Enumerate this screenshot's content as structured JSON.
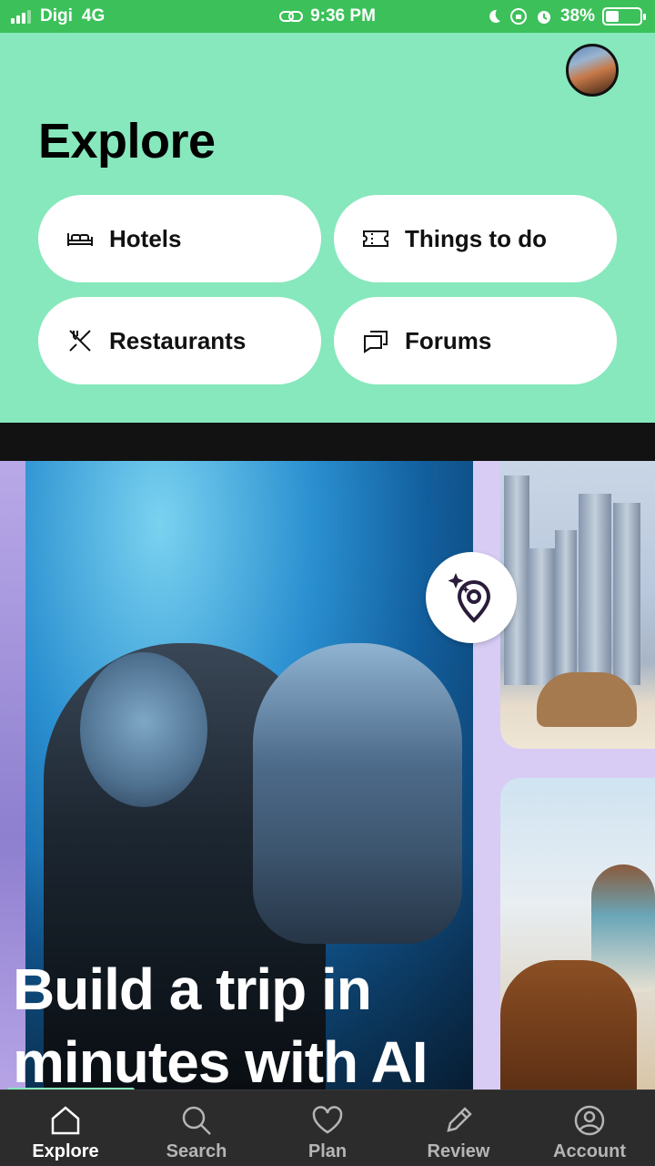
{
  "status_bar": {
    "carrier": "Digi",
    "network": "4G",
    "time": "9:36 PM",
    "battery_percent": "38%",
    "battery_level": 0.38
  },
  "header": {
    "title": "Explore",
    "background_color": "#86e8bc"
  },
  "categories": [
    {
      "label": "Hotels",
      "icon": "bed-icon"
    },
    {
      "label": "Things to do",
      "icon": "ticket-icon"
    },
    {
      "label": "Restaurants",
      "icon": "utensils-icon"
    },
    {
      "label": "Forums",
      "icon": "chat-icon"
    }
  ],
  "promo": {
    "headline": "Build a trip in minutes with AI",
    "badge_icon": "ai-sparkle-location-icon"
  },
  "bottom_nav": {
    "active": "Explore",
    "items": [
      {
        "label": "Explore",
        "icon": "home-icon"
      },
      {
        "label": "Search",
        "icon": "search-icon"
      },
      {
        "label": "Plan",
        "icon": "heart-icon"
      },
      {
        "label": "Review",
        "icon": "pencil-icon"
      },
      {
        "label": "Account",
        "icon": "user-icon"
      }
    ]
  }
}
